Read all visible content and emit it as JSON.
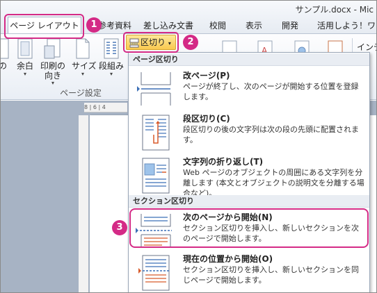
{
  "window": {
    "title": "サンプル.docx - Mic"
  },
  "tabs": {
    "active": "ページ レイアウト",
    "others": [
      "参考資料",
      "差し込み文書",
      "校閲",
      "表示",
      "開発",
      "活用しよう！ワード"
    ]
  },
  "ribbon": {
    "buttons": [
      {
        "label": "の",
        "icon": "orientation-icon"
      },
      {
        "label": "余白",
        "icon": "margins-icon"
      },
      {
        "label": "印刷の\n向き",
        "icon": "orientation-icon"
      },
      {
        "label": "サイズ",
        "icon": "page-size-icon"
      },
      {
        "label": "段組み",
        "icon": "columns-icon"
      }
    ],
    "group_label": "ページ設定",
    "breaks_button_label": "区切り",
    "indent_label": "インデ"
  },
  "badges": [
    "1",
    "2",
    "3"
  ],
  "ruler_text": "8  |  6  |  4",
  "menu": {
    "page_breaks_header": "ページ区切り",
    "section_breaks_header": "セクション区切り",
    "page_break": {
      "title": "改ページ(P)",
      "desc": "ページが終了し、次のページが開始する位置を登録します。",
      "icon": "page-break-icon"
    },
    "column_break": {
      "title": "段区切り(C)",
      "desc": "段区切りの後の文字列は次の段の先頭に配置されます。",
      "icon": "column-break-icon"
    },
    "text_wrapping": {
      "title": "文字列の折り返し(T)",
      "desc": "Web ページのオブジェクトの周囲にある文字列を分離します (本文とオブジェクトの説明文を分離する場合など)。",
      "icon": "text-wrapping-icon"
    },
    "next_page": {
      "title": "次のページから開始(N)",
      "desc": "セクション区切りを挿入し、新しいセクションを次のページで開始します。",
      "icon": "next-page-section-icon"
    },
    "continuous": {
      "title": "現在の位置から開始(O)",
      "desc": "セクション区切りを挿入し、新しいセクションを同じページで開始します。",
      "icon": "continuous-section-icon"
    }
  },
  "colors": {
    "highlight": "#d42a86",
    "button": "#f9c94f"
  }
}
